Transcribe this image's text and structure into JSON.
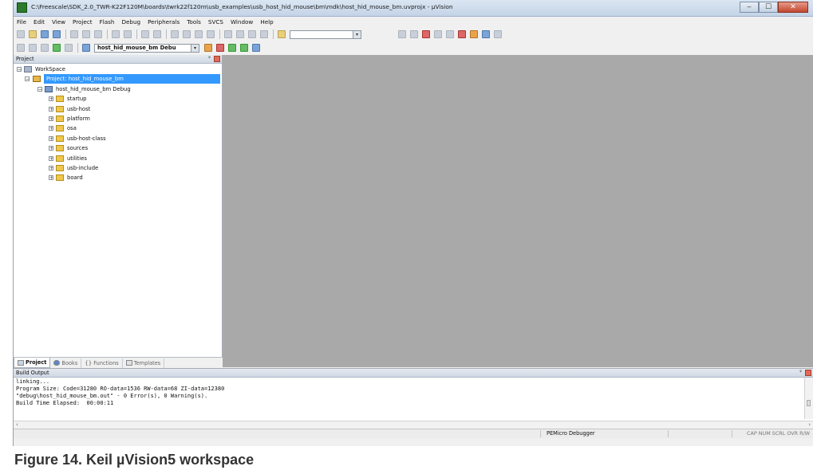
{
  "window": {
    "title": "C:\\Freescale\\SDK_2.0_TWR-K22F120M\\boards\\twrk22f120m\\usb_examples\\usb_host_hid_mouse\\bm\\mdk\\host_hid_mouse_bm.uvprojx - µVision"
  },
  "menubar": {
    "items": [
      "File",
      "Edit",
      "View",
      "Project",
      "Flash",
      "Debug",
      "Peripherals",
      "Tools",
      "SVCS",
      "Window",
      "Help"
    ]
  },
  "toolbar": {
    "target": "host_hid_mouse_bm Debu"
  },
  "project_panel": {
    "title": "Project",
    "tree": {
      "workspace": "WorkSpace",
      "project": "Project: host_hid_mouse_bm",
      "target": "host_hid_mouse_bm Debug",
      "groups": [
        "startup",
        "usb-host",
        "platform",
        "osa",
        "usb-host-class",
        "sources",
        "utilities",
        "usb-include",
        "board"
      ]
    },
    "tabs": [
      "Project",
      "Books",
      "Functions",
      "Templates"
    ]
  },
  "build_output": {
    "title": "Build Output",
    "lines": [
      "linking...",
      "Program Size: Code=31280 RO-data=1536 RW-data=68 ZI-data=12380",
      "\"debug\\host_hid_mouse_bm.out\" - 0 Error(s), 0 Warning(s).",
      "Build Time Elapsed:  00:00:11"
    ]
  },
  "statusbar": {
    "debugger": "PEMicro Debugger",
    "keys": "CAP  NUM  SCRL  OVR  R/W"
  },
  "caption": "Figure 14.  Keil µVision5 workspace"
}
